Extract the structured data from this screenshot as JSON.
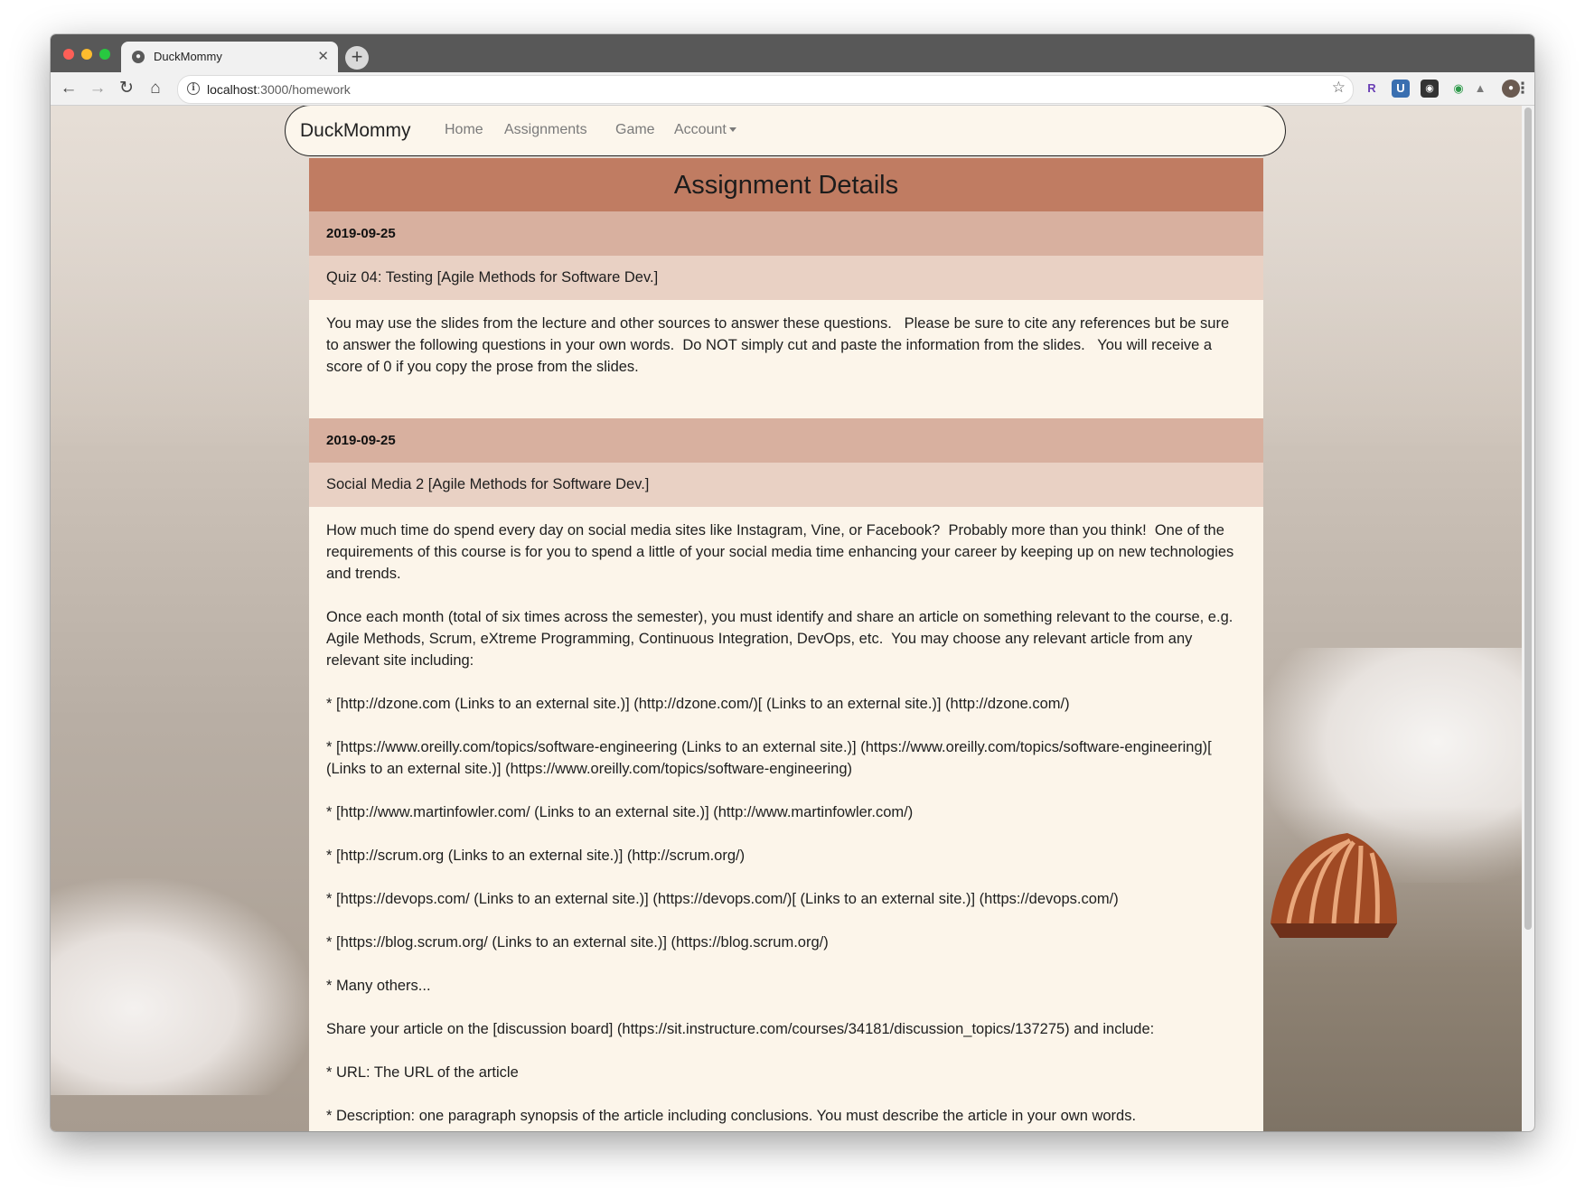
{
  "browser": {
    "tab_title": "DuckMommy",
    "url_host": "localhost",
    "url_path": ":3000/homework",
    "colors": {
      "titlebar": "#585858",
      "toolbar": "#f1f1f1"
    },
    "icons": [
      "back-icon",
      "forward-icon",
      "reload-icon",
      "home-icon",
      "info-icon",
      "star-icon",
      "menu-icon"
    ]
  },
  "navbar": {
    "brand": "DuckMommy",
    "links": [
      "Home",
      "Assignments",
      "Game",
      "Account"
    ]
  },
  "page": {
    "title": "Assignment Details",
    "colors": {
      "title_bg": "#c07c62",
      "date_bg": "#d8b09f",
      "name_bg": "#e9d1c4",
      "body_bg": "#fcf5ea"
    }
  },
  "assignments": [
    {
      "date": "2019-09-25",
      "name": "Quiz 04: Testing [Agile Methods for Software Dev.]",
      "paragraphs": [
        "You may use the slides from the lecture and other sources to answer these questions.   Please be sure to cite any references but be sure to answer the following questions in your own words.  Do NOT simply cut and paste the information from the slides.   You will receive a score of 0 if you copy the prose from the slides."
      ]
    },
    {
      "date": "2019-09-25",
      "name": "Social Media 2 [Agile Methods for Software Dev.]",
      "paragraphs": [
        "How much time do spend every day on social media sites like Instagram, Vine, or Facebook?  Probably more than you think!  One of the requirements of this course is for you to spend a little of your social media time enhancing your career by keeping up on new technologies and trends.",
        "Once each month (total of six times across the semester), you must identify and share an article on something relevant to the course, e.g. Agile Methods, Scrum, eXtreme Programming, Continuous Integration, DevOps, etc.  You may choose any relevant article from any relevant site including:",
        "* [http://dzone.com (Links to an external site.)] (http://dzone.com/)[ (Links to an external site.)] (http://dzone.com/)",
        "* [https://www.oreilly.com/topics/software-engineering (Links to an external site.)] (https://www.oreilly.com/topics/software-engineering)[ (Links to an external site.)] (https://www.oreilly.com/topics/software-engineering)",
        "* [http://www.martinfowler.com/ (Links to an external site.)] (http://www.martinfowler.com/)",
        "* [http://scrum.org (Links to an external site.)] (http://scrum.org/)",
        "* [https://devops.com/ (Links to an external site.)] (https://devops.com/)[ (Links to an external site.)] (https://devops.com/)",
        "* [https://blog.scrum.org/ (Links to an external site.)] (https://blog.scrum.org/)",
        "* Many others...",
        "Share your article on the [discussion board] (https://sit.instructure.com/courses/34181/discussion_topics/137275) and include:",
        "* URL: The URL of the article",
        "* Description: one paragraph synopsis of the article including conclusions. You must describe the article in your own words."
      ]
    }
  ]
}
